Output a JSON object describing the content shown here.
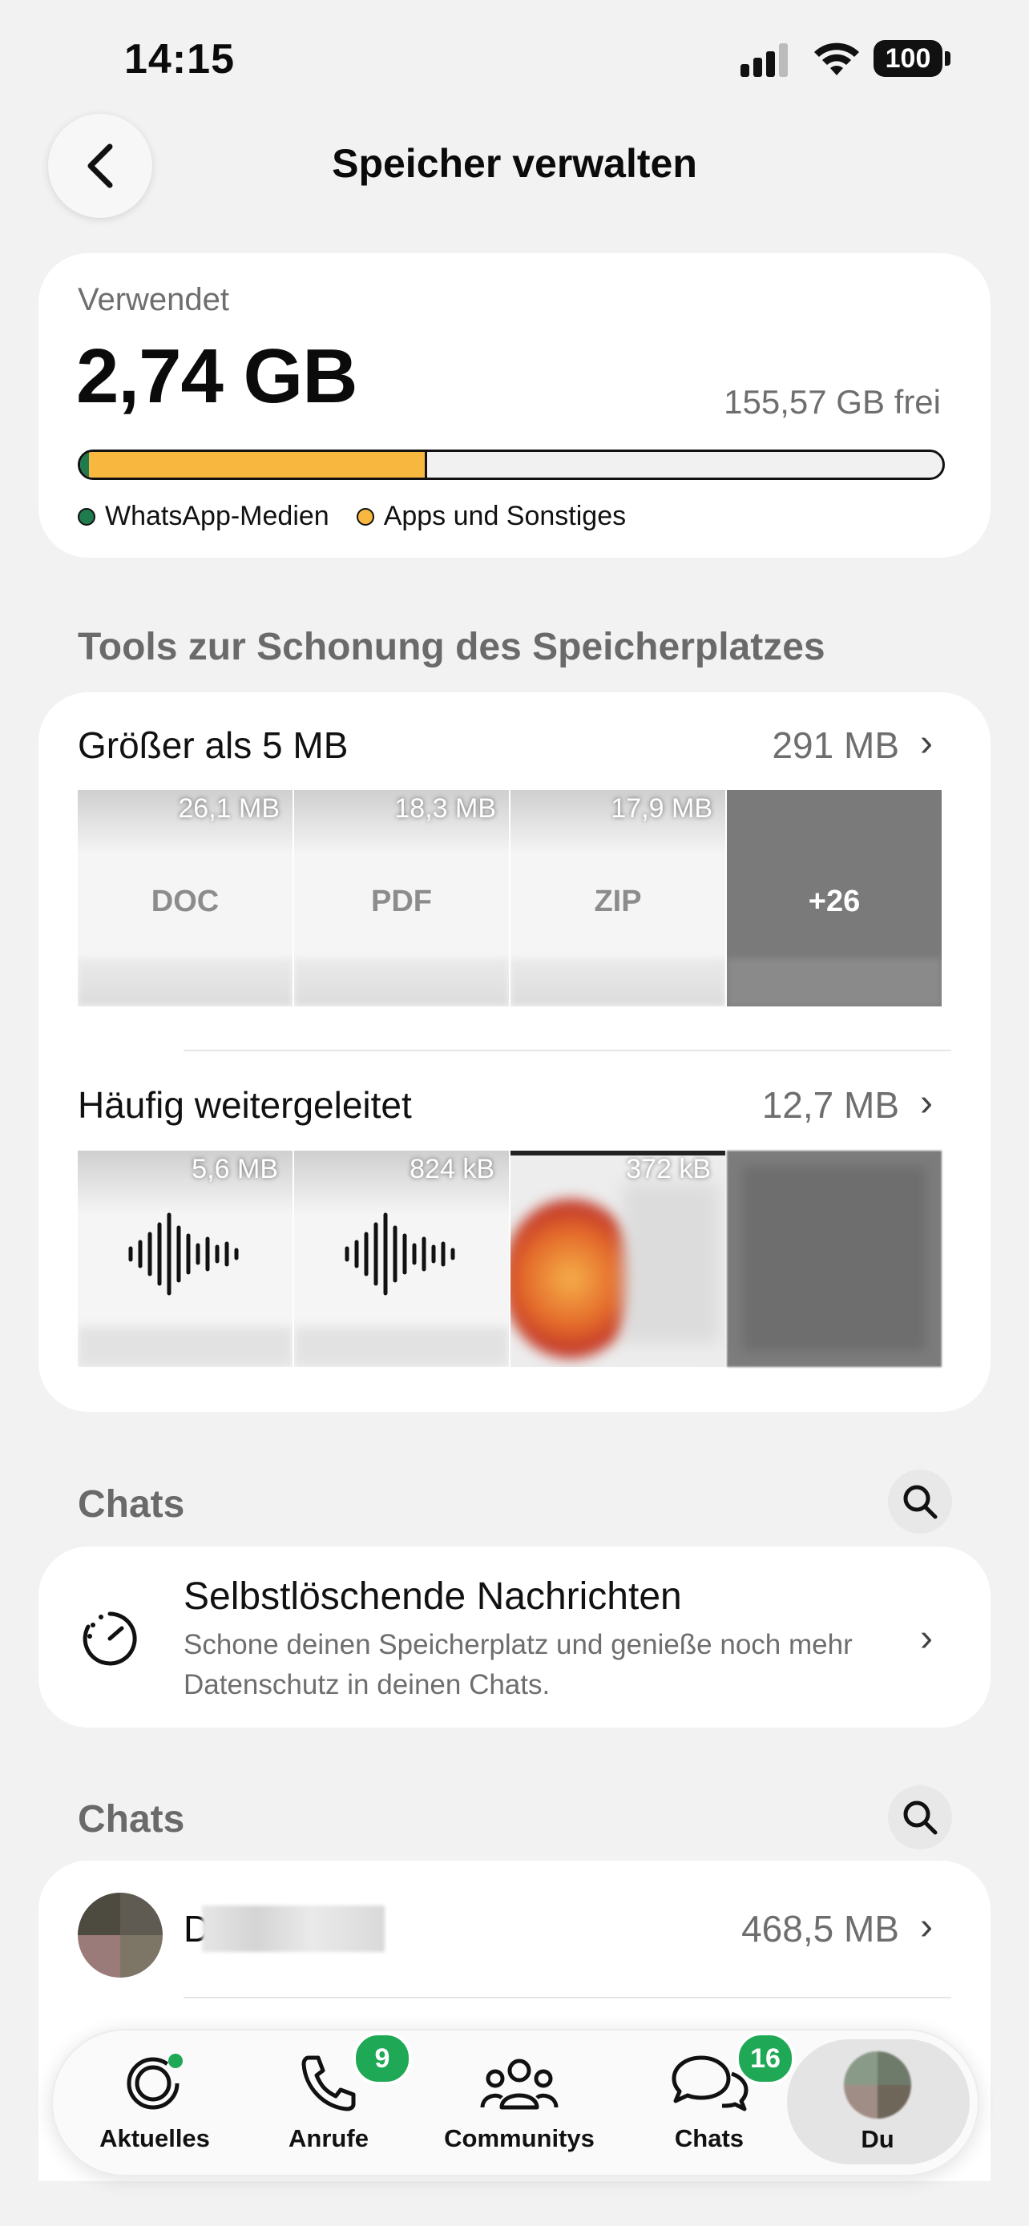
{
  "status_bar": {
    "time": "14:15",
    "battery": "100"
  },
  "header": {
    "title": "Speicher verwalten"
  },
  "storage": {
    "used_label": "Verwendet",
    "used_value": "2,74 GB",
    "free_value": "155,57 GB frei",
    "whatsapp_fraction": 0.01,
    "apps_fraction": 0.39,
    "legend": [
      {
        "label": "WhatsApp-Medien",
        "color": "#1f7a4d"
      },
      {
        "label": "Apps und Sonstiges",
        "color": "#f8b73e"
      }
    ]
  },
  "tools": {
    "title": "Tools zur Schonung des Speicherplatzes",
    "larger": {
      "label": "Größer als 5 MB",
      "value": "291 MB",
      "tiles": [
        {
          "size": "26,1 MB",
          "type": "DOC"
        },
        {
          "size": "18,3 MB",
          "type": "PDF"
        },
        {
          "size": "17,9 MB",
          "type": "ZIP"
        },
        {
          "size": "",
          "type": "+26"
        }
      ]
    },
    "forwarded": {
      "label": "Häufig weitergeleitet",
      "value": "12,7 MB",
      "tiles": [
        {
          "size": "5,6 MB"
        },
        {
          "size": "824 kB"
        },
        {
          "size": "372 kB"
        }
      ]
    }
  },
  "chats_section_1": {
    "title": "Chats",
    "disappearing": {
      "title": "Selbstlöschende Nachrichten",
      "subtitle": "Schone deinen Speicherplatz und genieße noch mehr Datenschutz in deinen Chats."
    }
  },
  "chats_section_2": {
    "title": "Chats",
    "items": [
      {
        "name_initial": "D",
        "size": "468,5 MB"
      }
    ]
  },
  "tabbar": {
    "items": [
      {
        "label": "Aktuelles",
        "icon": "status-icon"
      },
      {
        "label": "Anrufe",
        "icon": "phone-icon",
        "badge": "9"
      },
      {
        "label": "Communitys",
        "icon": "communities-icon"
      },
      {
        "label": "Chats",
        "icon": "chats-icon",
        "badge": "16"
      },
      {
        "label": "Du",
        "icon": "avatar"
      }
    ]
  }
}
